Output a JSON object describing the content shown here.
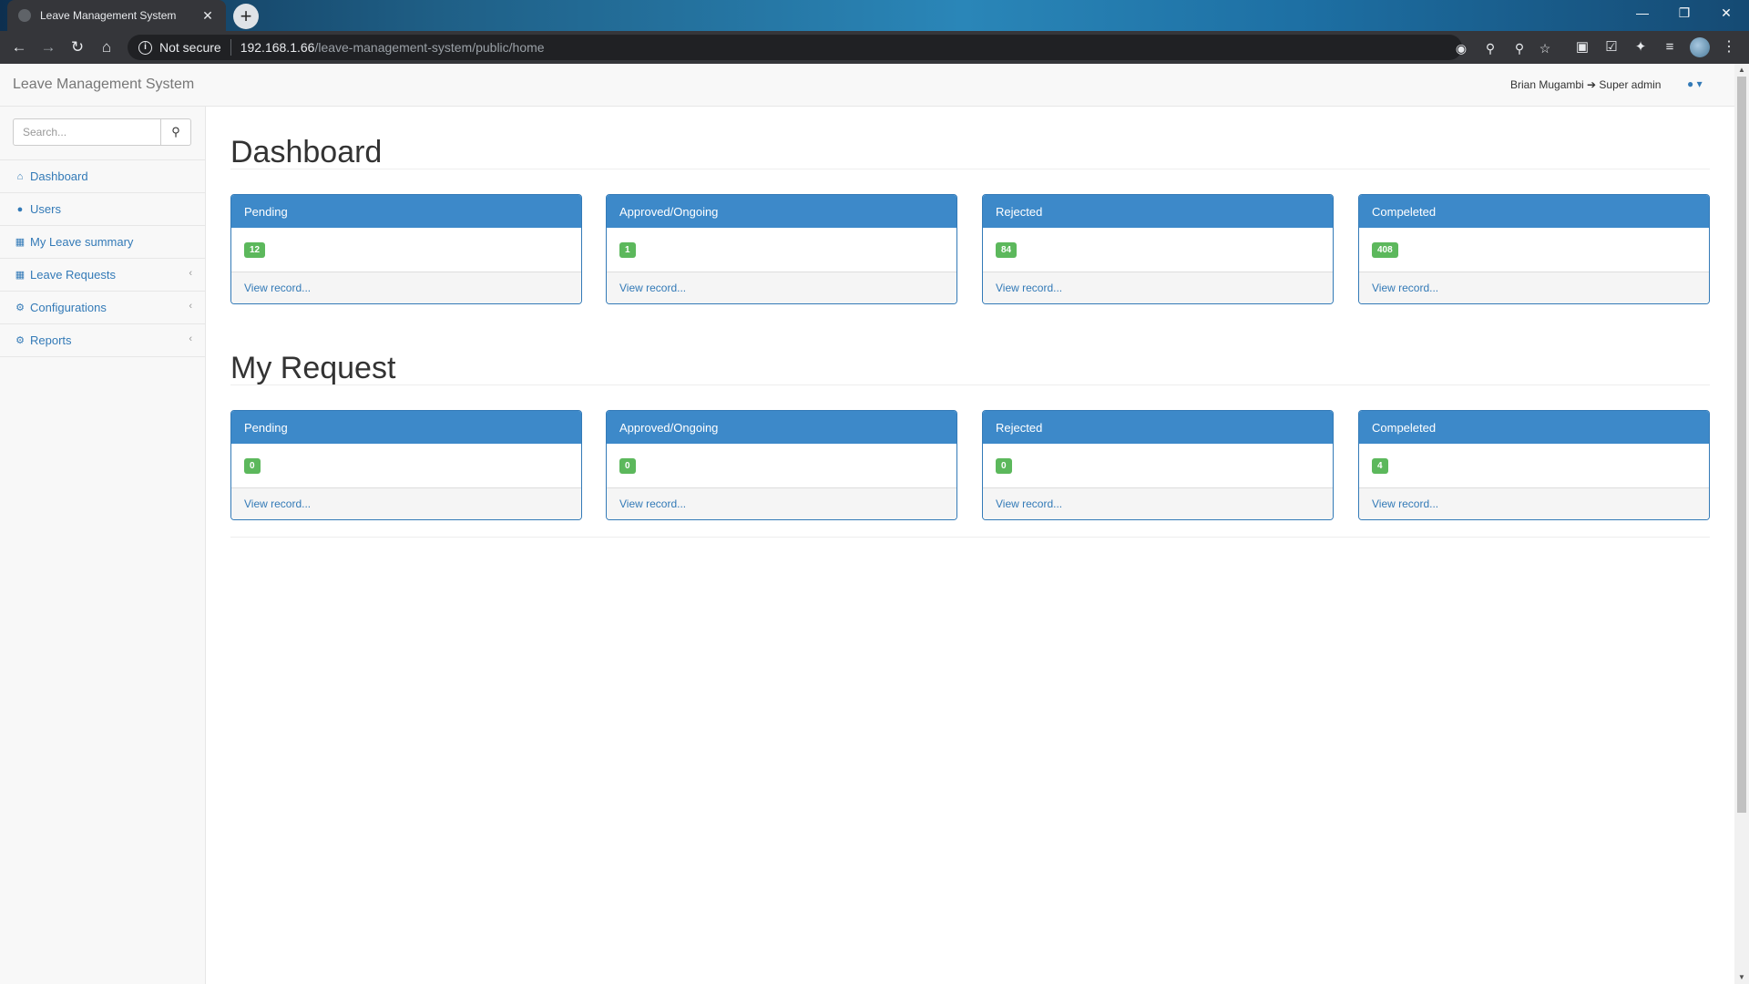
{
  "browser": {
    "tab_title": "Leave Management System",
    "tab_close": "✕",
    "new_tab": "+",
    "security_label": "Not secure",
    "url_host": "192.168.1.66",
    "url_path": "/leave-management-system/public/home",
    "window_controls": {
      "minimize": "—",
      "restore": "❐",
      "close": "✕"
    }
  },
  "app": {
    "brand": "Leave Management System",
    "user": "Brian Mugambi ➔ Super admin"
  },
  "sidebar": {
    "search_placeholder": "Search...",
    "items": [
      {
        "label": "Dashboard",
        "icon": "home-icon",
        "has_children": false
      },
      {
        "label": "Users",
        "icon": "users-icon",
        "has_children": false
      },
      {
        "label": "My Leave summary",
        "icon": "grid-icon",
        "has_children": false
      },
      {
        "label": "Leave Requests",
        "icon": "grid-icon",
        "has_children": true
      },
      {
        "label": "Configurations",
        "icon": "gear-icon",
        "has_children": true
      },
      {
        "label": "Reports",
        "icon": "gear-icon",
        "has_children": true
      }
    ]
  },
  "dashboard": {
    "title": "Dashboard",
    "cards": [
      {
        "heading": "Pending",
        "count": "12",
        "link": "View record..."
      },
      {
        "heading": "Approved/Ongoing",
        "count": "1",
        "link": "View record..."
      },
      {
        "heading": "Rejected",
        "count": "84",
        "link": "View record..."
      },
      {
        "heading": "Compeleted",
        "count": "408",
        "link": "View record..."
      }
    ]
  },
  "my_request": {
    "title": "My Request",
    "cards": [
      {
        "heading": "Pending",
        "count": "0",
        "link": "View record..."
      },
      {
        "heading": "Approved/Ongoing",
        "count": "0",
        "link": "View record..."
      },
      {
        "heading": "Rejected",
        "count": "0",
        "link": "View record..."
      },
      {
        "heading": "Compeleted",
        "count": "4",
        "link": "View record..."
      }
    ]
  },
  "colors": {
    "panel_heading": "#3d89c9",
    "badge": "#5cb85c",
    "link": "#337ab7"
  }
}
